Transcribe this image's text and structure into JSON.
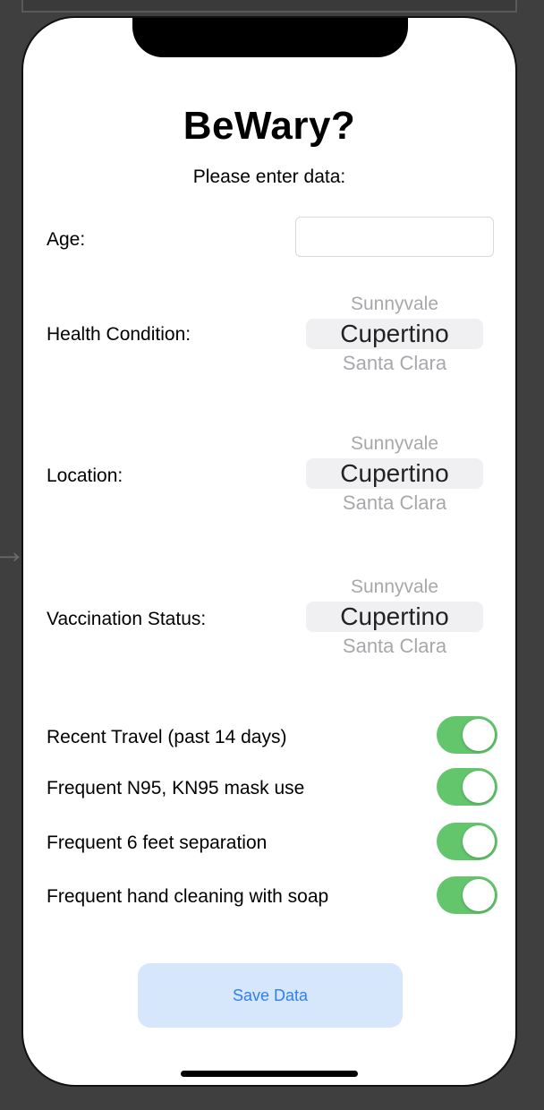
{
  "app": {
    "title": "BeWary?",
    "subtitle": "Please enter data:"
  },
  "form": {
    "age": {
      "label": "Age:",
      "value": "",
      "placeholder": ""
    },
    "health_condition": {
      "label": "Health Condition:",
      "options": [
        "Sunnyvale",
        "Cupertino",
        "Santa Clara"
      ],
      "selected": "Cupertino"
    },
    "location": {
      "label": "Location:",
      "options": [
        "Sunnyvale",
        "Cupertino",
        "Santa Clara"
      ],
      "selected": "Cupertino"
    },
    "vaccination_status": {
      "label": "Vaccination Status:",
      "options": [
        "Sunnyvale",
        "Cupertino",
        "Santa Clara"
      ],
      "selected": "Cupertino"
    },
    "toggles": [
      {
        "label": "Recent Travel (past 14 days)",
        "on": true
      },
      {
        "label": "Frequent N95, KN95 mask use",
        "on": true
      },
      {
        "label": "Frequent 6 feet separation",
        "on": true
      },
      {
        "label": "Frequent hand cleaning with soap",
        "on": true
      }
    ],
    "save_label": "Save Data"
  },
  "colors": {
    "toggle_on": "#63c66d",
    "button_bg": "#d6e6fb",
    "button_text": "#2f7ff0",
    "picker_selection": "#f0f0f2"
  }
}
